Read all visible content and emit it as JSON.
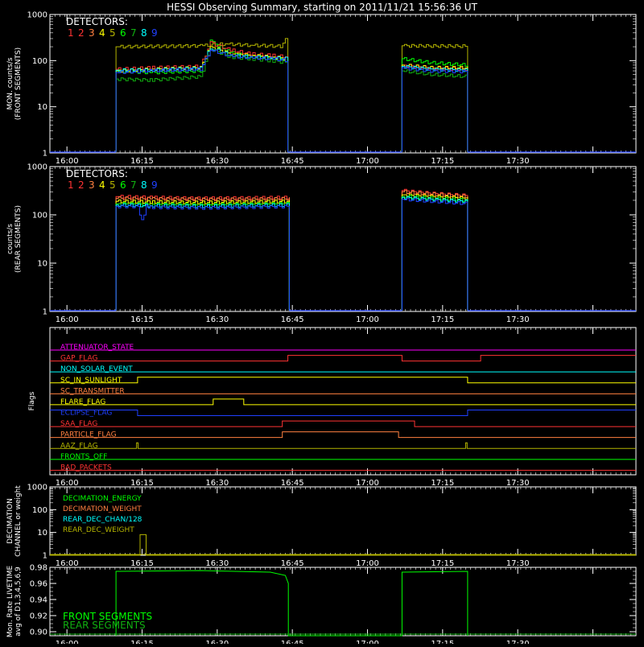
{
  "title": "HESSI Observing Summary, starting on 2011/11/21 15:56:36 UT",
  "colors": {
    "bg": "#000000",
    "axis": "#ffffff",
    "red": "#ff3333",
    "orange": "#ff8040",
    "yellow": "#ffff00",
    "olive": "#b4b400",
    "green": "#00ff00",
    "dkgreen": "#10b010",
    "cyan": "#00ffff",
    "blue": "#2040ff",
    "blue2": "#4080ff",
    "magenta": "#ff00ff"
  },
  "time_axis": {
    "xlim_min": [
      0,
      117
    ],
    "ticks_min": [
      3.4,
      18.4,
      33.4,
      48.4,
      63.4,
      78.4,
      93.4,
      108.4
    ],
    "tick_labels": [
      "16:00",
      "16:15",
      "16:30",
      "16:45",
      "17:00",
      "17:15",
      "17:30"
    ],
    "minor_step": 1
  },
  "chart_data": [
    {
      "type": "line",
      "ylabel": [
        "MON. counts/s",
        "(FRONT SEGMENTS)"
      ],
      "yscale": "log",
      "ylim": [
        1,
        1000
      ],
      "ytick_values": [
        1,
        10,
        100,
        1000
      ],
      "ytick_labels": [
        "1",
        "10",
        "100",
        "1000"
      ],
      "legend_title": "DETECTORS:",
      "legend": [
        "1",
        "2",
        "3",
        "4",
        "5",
        "6",
        "7",
        "8",
        "9"
      ],
      "legend_colors": [
        "#ff3333",
        "#ff3333",
        "#ff8040",
        "#ffff00",
        "#b4b400",
        "#00ff00",
        "#10b010",
        "#00ffff",
        "#2040ff"
      ],
      "intervals": [
        [
          13.2,
          47.5
        ],
        [
          70.3,
          83.4
        ]
      ],
      "series": [
        {
          "color": "#b4b400",
          "x": [
            13.2,
            30,
            35,
            40,
            46,
            47,
            47.5,
            70.3,
            83.4
          ],
          "y": [
            200,
            210,
            230,
            215,
            205,
            280,
            250,
            210,
            205
          ]
        },
        {
          "color": "#00ff00",
          "x": [
            13.2,
            20,
            30,
            32,
            36,
            40,
            44,
            47.5,
            70.3,
            76,
            83.4
          ],
          "y": [
            60,
            55,
            60,
            260,
            150,
            120,
            110,
            100,
            110,
            90,
            80
          ]
        },
        {
          "color": "#ff3333",
          "x": [
            13.2,
            20,
            30,
            32,
            36,
            40,
            44,
            47.5,
            70.3,
            76,
            83.4
          ],
          "y": [
            65,
            70,
            75,
            240,
            170,
            140,
            130,
            120,
            80,
            70,
            65
          ]
        },
        {
          "color": "#ffff00",
          "x": [
            13.2,
            20,
            30,
            32,
            36,
            40,
            44,
            47.5,
            70.3,
            76,
            83.4
          ],
          "y": [
            60,
            65,
            70,
            200,
            140,
            130,
            120,
            110,
            80,
            70,
            70
          ]
        },
        {
          "color": "#00ffff",
          "x": [
            13.2,
            20,
            30,
            32,
            36,
            40,
            44,
            47.5,
            70.3,
            76,
            83.4
          ],
          "y": [
            62,
            62,
            68,
            190,
            130,
            120,
            115,
            110,
            75,
            65,
            62
          ]
        },
        {
          "color": "#10b010",
          "x": [
            13.2,
            20,
            30,
            32,
            36,
            40,
            44,
            47.5,
            70.3,
            76,
            83.4
          ],
          "y": [
            40,
            38,
            45,
            180,
            120,
            110,
            100,
            90,
            60,
            50,
            45
          ]
        },
        {
          "color": "#2040ff",
          "x": [
            13.2,
            20,
            30,
            32,
            36,
            40,
            44,
            47.5,
            70.3,
            76,
            83.4
          ],
          "y": [
            55,
            60,
            65,
            170,
            125,
            115,
            110,
            100,
            70,
            60,
            58
          ]
        }
      ]
    },
    {
      "type": "line",
      "ylabel": [
        "counts/s",
        "(REAR SEGMENTS)"
      ],
      "yscale": "log",
      "ylim": [
        1,
        1000
      ],
      "ytick_values": [
        1,
        10,
        100,
        1000
      ],
      "ytick_labels": [
        "1",
        "10",
        "100",
        "1000"
      ],
      "legend_title": "DETECTORS:",
      "legend": [
        "1",
        "2",
        "3",
        "4",
        "5",
        "6",
        "7",
        "8",
        "9"
      ],
      "legend_colors": [
        "#ff3333",
        "#ff3333",
        "#ff8040",
        "#ffff00",
        "#b4b400",
        "#00ff00",
        "#10b010",
        "#00ffff",
        "#2040ff"
      ],
      "intervals": [
        [
          13.2,
          47.8
        ],
        [
          70.3,
          83.4
        ]
      ],
      "series": [
        {
          "color": "#ff3333",
          "x": [
            13.2,
            20,
            30,
            40,
            47.8,
            70.3,
            76,
            83.4
          ],
          "y": [
            240,
            230,
            220,
            225,
            230,
            320,
            280,
            250
          ]
        },
        {
          "color": "#ff8040",
          "x": [
            13.2,
            20,
            30,
            40,
            47.8,
            70.3,
            76,
            83.4
          ],
          "y": [
            220,
            215,
            210,
            210,
            215,
            300,
            270,
            240
          ]
        },
        {
          "color": "#ffff00",
          "x": [
            13.2,
            20,
            30,
            40,
            47.8,
            70.3,
            76,
            83.4
          ],
          "y": [
            190,
            185,
            180,
            185,
            190,
            260,
            240,
            220
          ]
        },
        {
          "color": "#00ff00",
          "x": [
            13.2,
            20,
            30,
            40,
            47.8,
            70.3,
            76,
            83.4
          ],
          "y": [
            170,
            165,
            160,
            165,
            170,
            240,
            220,
            200
          ]
        },
        {
          "color": "#00ffff",
          "x": [
            13.2,
            20,
            30,
            40,
            47.8,
            70.3,
            76,
            83.4
          ],
          "y": [
            160,
            155,
            150,
            155,
            160,
            230,
            210,
            190
          ]
        },
        {
          "color": "#2040ff",
          "x": [
            13.2,
            17.5,
            18.3,
            19.2,
            20,
            30,
            40,
            47.8,
            70.3,
            76,
            83.4
          ],
          "y": [
            150,
            150,
            75,
            150,
            145,
            140,
            145,
            150,
            210,
            190,
            170
          ]
        }
      ]
    },
    {
      "type": "line",
      "ylabel": [
        "Flags"
      ],
      "flags": [
        {
          "name": "ATTENUATOR_STATE",
          "color": "#ff00ff",
          "changes": [],
          "states": [
            0
          ]
        },
        {
          "name": "GAP_FLAG",
          "color": "#ff3333",
          "changes": [
            47.5,
            70.3,
            86.0
          ],
          "states": [
            0,
            1,
            0,
            1
          ]
        },
        {
          "name": "NON_SOLAR_EVENT",
          "color": "#00ffff",
          "changes": [],
          "states": [
            0
          ]
        },
        {
          "name": "SC_IN_SUNLIGHT",
          "color": "#ffff00",
          "changes": [
            17.5,
            83.4
          ],
          "states": [
            0,
            1,
            0
          ]
        },
        {
          "name": "SC_TRANSMITTER",
          "color": "#ff8040",
          "changes": [],
          "states": [
            0
          ]
        },
        {
          "name": "FLARE_FLAG",
          "color": "#ffff00",
          "changes": [
            32.6,
            38.7
          ],
          "states": [
            0,
            1,
            0
          ]
        },
        {
          "name": "ECLIPSE_FLAG",
          "color": "#2040ff",
          "changes": [
            17.5,
            83.4
          ],
          "states": [
            1,
            0,
            1
          ]
        },
        {
          "name": "SAA_FLAG",
          "color": "#ff3333",
          "changes": [
            46.4,
            72.8
          ],
          "states": [
            0,
            1,
            0
          ]
        },
        {
          "name": "PARTICLE_FLAG",
          "color": "#ff8040",
          "changes": [
            46.4,
            69.6
          ],
          "states": [
            0,
            1,
            0
          ]
        },
        {
          "name": "AAZ_FLAG",
          "color": "#b4b400",
          "changes": [
            17.3,
            17.6,
            83.0,
            83.3
          ],
          "states": [
            0,
            1,
            0,
            1,
            0
          ]
        },
        {
          "name": "FRONTS_OFF",
          "color": "#00ff00",
          "changes": [],
          "states": [
            0
          ]
        },
        {
          "name": "BAD_PACKETS",
          "color": "#ff3333",
          "changes": [],
          "states": [
            0
          ]
        }
      ]
    },
    {
      "type": "line",
      "ylabel": [
        "DECIMATION",
        "CHANNEL or weight"
      ],
      "yscale": "log",
      "ylim": [
        1,
        1000
      ],
      "ytick_values": [
        1,
        10,
        100,
        1000
      ],
      "ytick_labels": [
        "1",
        "10",
        "100",
        "1000"
      ],
      "legend": [
        "DECIMATION_ENERGY",
        "DECIMATION_WEIGHT",
        "REAR_DEC_CHAN/128",
        "REAR_DEC_WEIGHT"
      ],
      "legend_colors": [
        "#00ff00",
        "#ff8040",
        "#00ffff",
        "#b4b400"
      ],
      "series": [
        {
          "color": "#b4b400",
          "x": [
            0,
            18.0,
            18.0,
            19.2,
            19.2,
            117
          ],
          "y": [
            1,
            1,
            8,
            8,
            1,
            1
          ]
        }
      ]
    },
    {
      "type": "line",
      "ylabel": [
        "Mon. Rate LIVETIME",
        "avg of D1,3,4,5,6,9"
      ],
      "ylim": [
        0.895,
        0.98
      ],
      "ytick_values": [
        0.9,
        0.92,
        0.94,
        0.96,
        0.98
      ],
      "ytick_labels": [
        "0.90",
        "0.92",
        "0.94",
        "0.96",
        "0.98"
      ],
      "legend": [
        "FRONT SEGMENTS",
        "REAR SEGMENTS"
      ],
      "legend_colors": [
        "#00ff00",
        "#10b010"
      ],
      "series": [
        {
          "color": "#00ff00",
          "x": [
            13.2,
            13.2,
            30,
            44,
            47.0,
            47.6,
            47.6,
            70.3,
            70.3,
            83.4,
            83.4
          ],
          "y": [
            0.895,
            0.975,
            0.976,
            0.974,
            0.97,
            0.96,
            0.895,
            0.895,
            0.974,
            0.975,
            0.895
          ]
        }
      ]
    }
  ]
}
